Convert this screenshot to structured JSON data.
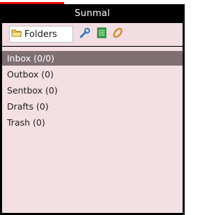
{
  "window": {
    "title": "Sunmal"
  },
  "toolbar": {
    "folders_tab": {
      "label": "Folders",
      "icon": "folder-icon"
    },
    "buttons": [
      {
        "name": "settings-button",
        "icon": "wrench-icon"
      },
      {
        "name": "notes-button",
        "icon": "notepad-icon"
      },
      {
        "name": "attach-button",
        "icon": "paperclip-icon"
      }
    ]
  },
  "folders": [
    {
      "label": "Inbox (0/0)",
      "selected": true
    },
    {
      "label": "Outbox (0)",
      "selected": false
    },
    {
      "label": "Sentbox (0)",
      "selected": false
    },
    {
      "label": "Drafts (0)",
      "selected": false
    },
    {
      "label": "Trash (0)",
      "selected": false
    }
  ],
  "colors": {
    "titlebar": "#000000",
    "panel": "#f4dfe3",
    "selection": "#7f6f72",
    "accent": "#e00000"
  }
}
